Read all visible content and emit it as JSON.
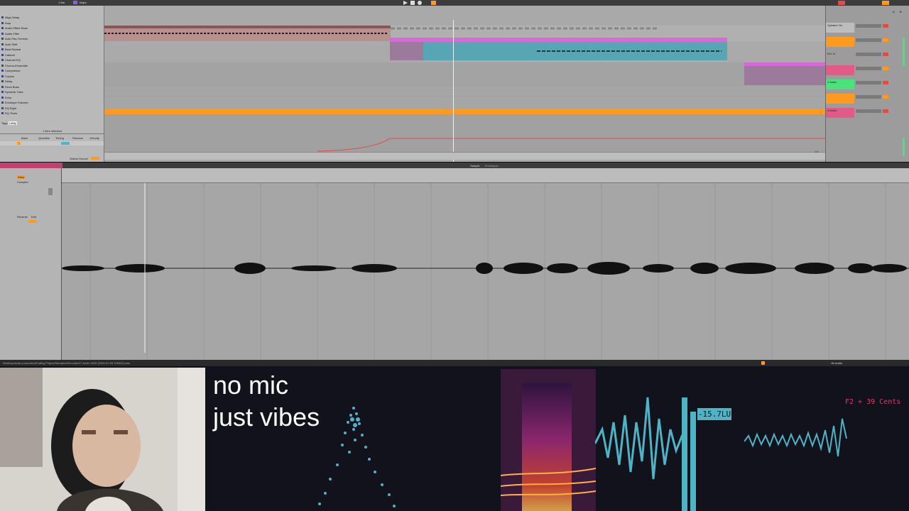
{
  "app": {
    "transport_selection": "1 Bar",
    "scale": "Major"
  },
  "browser": {
    "items": [
      "Align Delay",
      "Amp",
      "Audio Effect Rack",
      "Audio Filter",
      "Auto Pan-Tremolo",
      "Auto Shift",
      "Beat Repeat",
      "Cabinet",
      "Channel EQ",
      "Chorus-Ensemble",
      "Compressor",
      "Corpus",
      "Delay",
      "Drum Buss",
      "Dynamic Tube",
      "Echo",
      "Envelope Follower",
      "EQ Eight",
      "EQ Three"
    ],
    "selection_note": "1 item selected",
    "device_labels": [
      "Base",
      "Quantize",
      "Timing",
      "Random",
      "Velocity"
    ],
    "tags": [
      "Tags",
      "Utility"
    ]
  },
  "arrangement": {
    "bottom_label": "Global Groove",
    "page_counter": "1/8"
  },
  "mixer": {
    "tracks": [
      {
        "name": "Speaker On",
        "color": "#bdbdbd"
      },
      {
        "name": "",
        "color": "#ff9a1f"
      },
      {
        "name": "Ext. In",
        "color": "#9c9c9c"
      },
      {
        "name": "",
        "color": "#e25a86"
      },
      {
        "name": "2 Audio",
        "color": "#49e37b"
      },
      {
        "name": "",
        "color": "#ff9a1f"
      },
      {
        "name": "4 Audio",
        "color": "#e25a86"
      }
    ],
    "send_a": "A",
    "send_b": "B"
  },
  "detail": {
    "tab_sample": "Sample",
    "tab_envelopes": "Envelopes",
    "clip_controls": [
      "Warp",
      "Complex",
      "Reverse",
      "Edit"
    ]
  },
  "status": {
    "path_text": "Desktop/music production/Falling Project/Samples/Recorded/7-Audio 0005 [2026-02-05 100001].wav",
    "right_track": "16-Audio"
  },
  "overlay": {
    "caption_line1": "no mic",
    "caption_line2": "just vibes",
    "loudness": "-15.7LU",
    "pitch": "F2 + 39 Cents"
  },
  "colors": {
    "clip_orange": "#ff9a1f",
    "clip_pink": "#d66bd7",
    "clip_teal": "#56a7b3",
    "viz_cyan": "#4fb3c6",
    "accent_red": "#e34b4b"
  }
}
